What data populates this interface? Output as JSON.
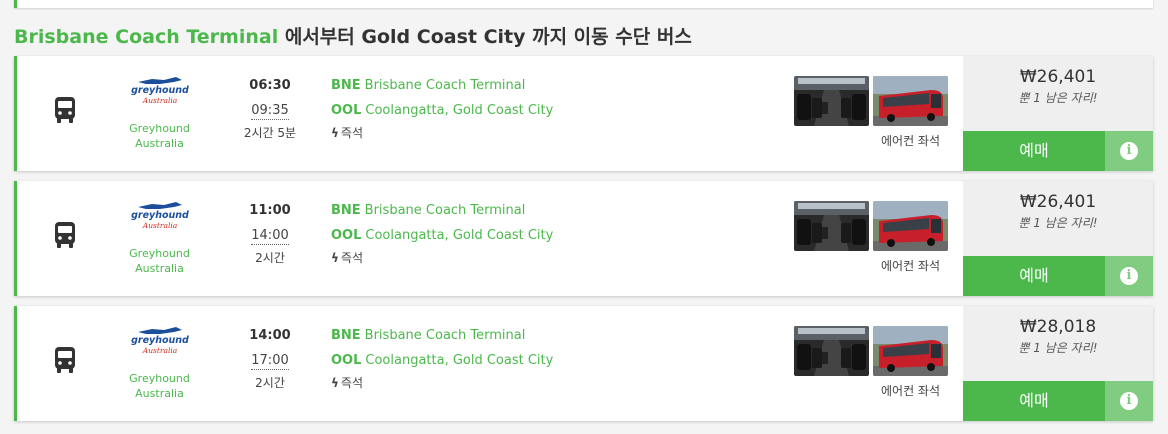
{
  "heading": {
    "from": "Brisbane Coach Terminal",
    "rest": " 에서부터 Gold Coast City 까지 이동 수단 버스"
  },
  "results": [
    {
      "operator": "Greyhound Australia",
      "departure": "06:30",
      "arrival": "09:35",
      "duration": "2시간 5분",
      "origin_code": "BNE",
      "origin_name": "Brisbane Coach Terminal",
      "dest_code": "OOL",
      "dest_name": "Coolangatta, Gold Coast City",
      "feature": "즉석",
      "amenity": "에어컨 좌석",
      "price": "₩26,401",
      "seats_left": "뿐 1 남은 자리!",
      "book_label": "예매"
    },
    {
      "operator": "Greyhound Australia",
      "departure": "11:00",
      "arrival": "14:00",
      "duration": "2시간",
      "origin_code": "BNE",
      "origin_name": "Brisbane Coach Terminal",
      "dest_code": "OOL",
      "dest_name": "Coolangatta, Gold Coast City",
      "feature": "즉석",
      "amenity": "에어컨 좌석",
      "price": "₩26,401",
      "seats_left": "뿐 1 남은 자리!",
      "book_label": "예매"
    },
    {
      "operator": "Greyhound Australia",
      "departure": "14:00",
      "arrival": "17:00",
      "duration": "2시간",
      "origin_code": "BNE",
      "origin_name": "Brisbane Coach Terminal",
      "dest_code": "OOL",
      "dest_name": "Coolangatta, Gold Coast City",
      "feature": "즉석",
      "amenity": "에어컨 좌석",
      "price": "₩28,018",
      "seats_left": "뿐 1 남은 자리!",
      "book_label": "예매"
    }
  ],
  "logo": {
    "line1": "greyhound",
    "line2": "Australia"
  },
  "icons": {
    "transport": "bus-icon",
    "feature": "lightning-icon",
    "info": "info-icon"
  },
  "colors": {
    "accent": "#4cb84c",
    "info_button": "#80cc80",
    "logo_blue": "#1b4f9c",
    "logo_red": "#d52b1e"
  }
}
